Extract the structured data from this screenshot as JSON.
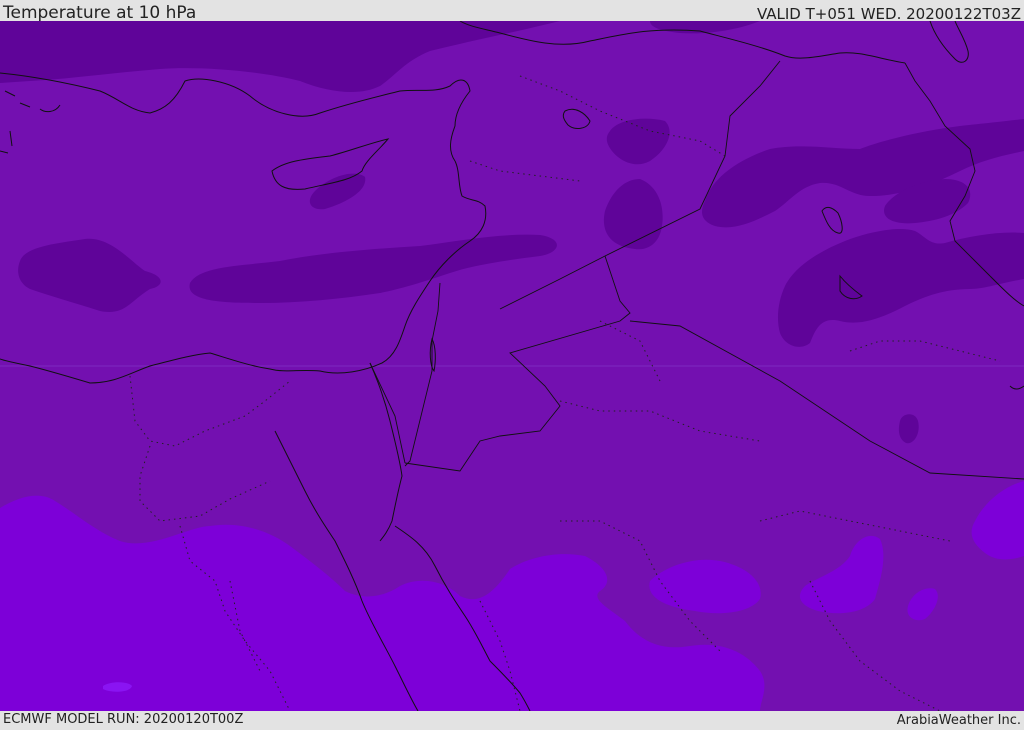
{
  "header": {
    "title": "Temperature at 10 hPa",
    "valid": "VALID T+051 WED. 20200122T03Z"
  },
  "footer": {
    "model_run": "ECMWF MODEL RUN: 20200120T00Z",
    "credit": "ArabiaWeather Inc."
  },
  "colors": {
    "field_mid": "#7310b0",
    "field_cold": "#5f0499",
    "field_warm": "#7d00d8",
    "field_warmest": "#8a14f2",
    "coastline": "#111111",
    "bar": "#e3e3e3"
  }
}
